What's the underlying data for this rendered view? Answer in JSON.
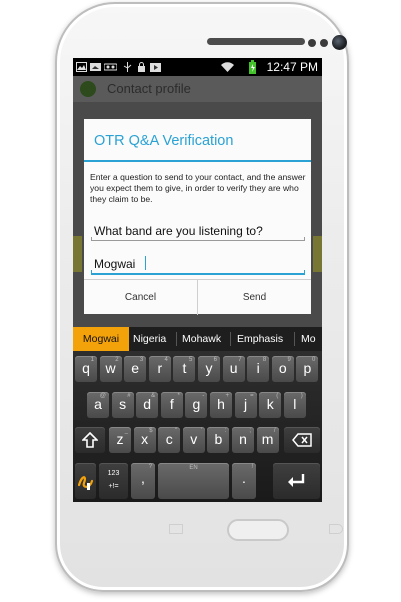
{
  "status_bar": {
    "time": "12:47 PM",
    "battery_level": "charging",
    "icons": [
      "image-icon",
      "gallery-icon",
      "voicemail-icon",
      "usb-icon",
      "lock-icon",
      "play-store-icon",
      "wifi-icon",
      "battery-icon"
    ]
  },
  "app": {
    "title": "Contact profile"
  },
  "dialog": {
    "title": "OTR Q&A Verification",
    "message": "Enter a question to send to your contact, and the answer you expect them to give, in order to verify they are who they claim to be.",
    "question_value": "What band are you listening to?",
    "answer_value": "Mogwai",
    "cancel_label": "Cancel",
    "send_label": "Send"
  },
  "suggestions": {
    "selected": "Mogwai",
    "items": [
      "Mogwai",
      "Nigeria",
      "Mohawk",
      "Emphasis",
      "Mo"
    ]
  },
  "keyboard": {
    "row1": [
      "q",
      "w",
      "e",
      "r",
      "t",
      "y",
      "u",
      "i",
      "o",
      "p"
    ],
    "row1_hints": [
      "1",
      "2",
      "3",
      "4",
      "5",
      "6",
      "7",
      "8",
      "9",
      "0"
    ],
    "row2": [
      "a",
      "s",
      "d",
      "f",
      "g",
      "h",
      "j",
      "k",
      "l"
    ],
    "row2_hints": [
      "@",
      "#",
      "&",
      "*",
      "-",
      "+",
      "=",
      "(",
      ")"
    ],
    "row3": [
      "z",
      "x",
      "c",
      "v",
      "b",
      "n",
      "m"
    ],
    "row3_hints": [
      "_",
      "$",
      "\"",
      "'",
      ":",
      ";",
      "/"
    ],
    "symbols_key_top": "123",
    "symbols_key_bottom": "+!=",
    "space_label": "EN",
    "comma_label": ",",
    "comma_hint": "?",
    "period_label": ".",
    "period_hint": "!"
  },
  "colors": {
    "accent": "#2ba2d4",
    "suggestion_highlight": "#f4a20a",
    "dialog_bg": "#fbfbfb",
    "keyboard_key": "#5a5a5a"
  }
}
